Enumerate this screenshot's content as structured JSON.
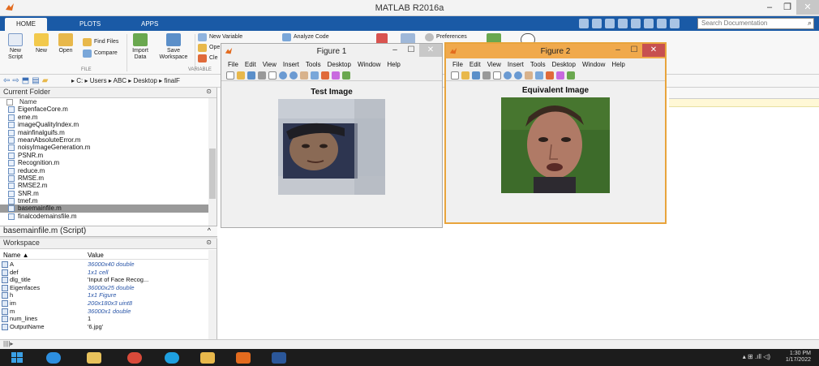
{
  "window": {
    "title": "MATLAB R2016a"
  },
  "tabs": [
    "HOME",
    "PLOTS",
    "APPS"
  ],
  "search": {
    "placeholder": "Search Documentation"
  },
  "ribbon": {
    "new_script": "New Script",
    "new": "New",
    "open": "Open",
    "find_files": "Find Files",
    "compare": "Compare",
    "import_data": "Import Data",
    "save_workspace": "Save Workspace",
    "new_variable": "New Variable",
    "open_variable": "Ope",
    "clear_workspace": "Cle",
    "analyze_code": "Analyze Code",
    "preferences": "Preferences",
    "group_file": "FILE",
    "group_variable": "VARIABLE"
  },
  "address": {
    "path": "▸ C: ▸ Users ▸ ABC ▸ Desktop ▸ finalF"
  },
  "current_folder": {
    "title": "Current Folder",
    "column_name": "Name",
    "files": [
      "EigenfaceCore.m",
      "eme.m",
      "imageQualityIndex.m",
      "mainfinalguifs.m",
      "meanAbsoluteError.m",
      "noisyImageGeneration.m",
      "PSNR.m",
      "Recognition.m",
      "reduce.m",
      "RMSE.m",
      "RMSE2.m",
      "SNR.m",
      "tmef.m",
      "basemainfile.m",
      "finalcodemainsfile.m"
    ],
    "selected_index": 13
  },
  "script_bar": {
    "label": "basemainfile.m  (Script)"
  },
  "workspace": {
    "title": "Workspace",
    "col_name": "Name ▲",
    "col_value": "Value",
    "rows": [
      {
        "name": "A",
        "value": "36000x40 double",
        "italic": true
      },
      {
        "name": "def",
        "value": "1x1 cell",
        "italic": true
      },
      {
        "name": "dlg_title",
        "value": "'Input of Face Recog...",
        "italic": false
      },
      {
        "name": "Eigenfaces",
        "value": "36000x25 double",
        "italic": true
      },
      {
        "name": "h",
        "value": "1x1 Figure",
        "italic": true
      },
      {
        "name": "im",
        "value": "200x180x3 uint8",
        "italic": true
      },
      {
        "name": "m",
        "value": "36000x1 double",
        "italic": true
      },
      {
        "name": "num_lines",
        "value": "1",
        "italic": false
      },
      {
        "name": "OutputName",
        "value": "'6.jpg'",
        "italic": false
      }
    ]
  },
  "figure1": {
    "title": "Figure 1",
    "menu": [
      "File",
      "Edit",
      "View",
      "Insert",
      "Tools",
      "Desktop",
      "Window",
      "Help"
    ],
    "image_title": "Test Image"
  },
  "figure2": {
    "title": "Figure 2",
    "menu": [
      "File",
      "Edit",
      "View",
      "Insert",
      "Tools",
      "Desktop",
      "Window",
      "Help"
    ],
    "image_title": "Equivalent Image"
  },
  "taskbar": {
    "time": "1:30 PM",
    "date": "1/17/2022"
  },
  "colors": {
    "ribbon_blue": "#1a5aa6",
    "figure2_border": "#e8a43c",
    "selected_row": "#9a9a9a"
  }
}
